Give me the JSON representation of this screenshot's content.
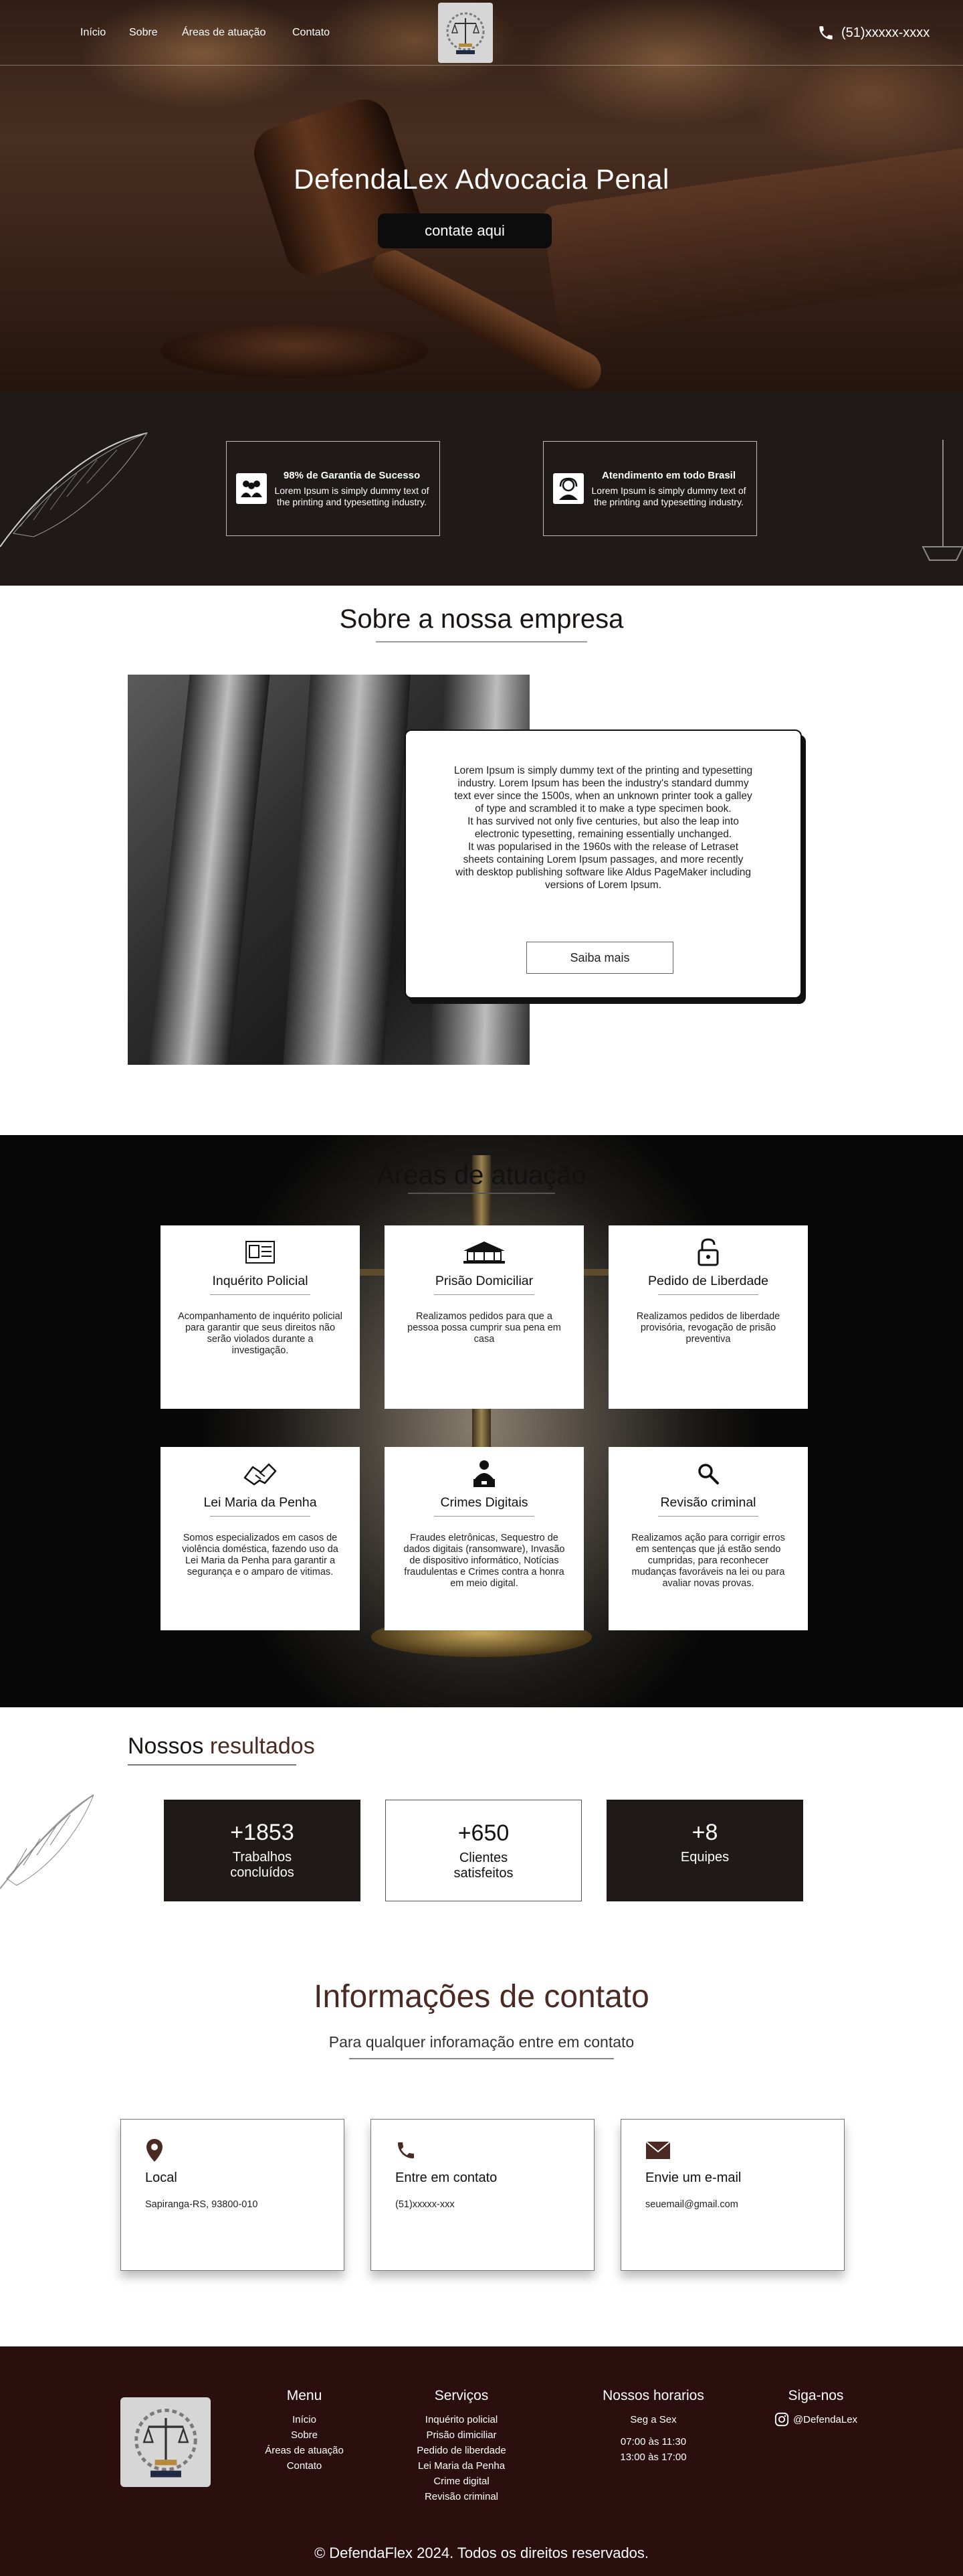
{
  "nav": {
    "links": [
      "Início",
      "Sobre",
      "Áreas de atuação",
      "Contato"
    ],
    "phone": "(51)xxxxx-xxxx"
  },
  "hero": {
    "title": "DefendaLex Advocacia Penal",
    "cta": "contate aqui"
  },
  "features": [
    {
      "title": "98% de Garantia de Sucesso",
      "text": "Lorem Ipsum is simply dummy text of the printing and typesetting industry.",
      "icon": "team-icon"
    },
    {
      "title": "Atendimento em todo Brasil",
      "text": "Lorem Ipsum is simply dummy text of the printing and typesetting industry.",
      "icon": "support-agent-icon"
    }
  ],
  "about": {
    "title": "Sobre a nossa empresa",
    "text": "Lorem Ipsum is simply dummy text of the printing and typesetting industry. Lorem Ipsum has been the industry's standard dummy text ever since the 1500s, when an unknown printer took a galley of type and scrambled it to make a type specimen book.\nIt has survived not only five centuries, but also the leap into electronic typesetting, remaining essentially unchanged.\nIt was popularised in the 1960s with the release of Letraset sheets containing Lorem Ipsum passages, and more recently with desktop publishing software like Aldus PageMaker including versions of Lorem Ipsum.",
    "button": "Saiba mais"
  },
  "areas": {
    "title": "Áreas de atuação",
    "items": [
      {
        "title": "Inquérito Policial",
        "text": "Acompanhamento de inquérito policial para garantir que seus direitos não serão violados durante a investigação.",
        "icon": "police-file-icon"
      },
      {
        "title": "Prisão Domiciliar",
        "text": "Realizamos pedidos para que a pessoa possa cumprir sua pena em casa",
        "icon": "house-icon"
      },
      {
        "title": "Pedido de Liberdade",
        "text": "Realizamos pedidos de liberdade provisória, revogação de prisão preventiva",
        "icon": "unlock-icon"
      },
      {
        "title": "Lei Maria da Penha",
        "text": "Somos especializados em casos de violência doméstica, fazendo uso da Lei Maria da Penha para garantir a segurança e o amparo de vitimas.",
        "icon": "handshake-icon"
      },
      {
        "title": "Crimes Digitais",
        "text": "Fraudes eletrônicas, Sequestro de dados digitais (ransomware), Invasão de dispositivo informático, Notícias fraudulentas e Crimes contra a honra em meio digital.",
        "icon": "computer-user-icon"
      },
      {
        "title": "Revisão criminal",
        "text": "Realizamos ação para corrigir erros em sentenças que já estão sendo cumpridas, para reconhecer mudanças favoráveis na lei ou para avaliar novas provas.",
        "icon": "search-icon"
      }
    ]
  },
  "results": {
    "title_a": "Nossos",
    "title_b": "resultados",
    "stats": [
      {
        "value": "+1853",
        "label_1": "Trabalhos",
        "label_2": "concluídos"
      },
      {
        "value": "+650",
        "label_1": "Clientes",
        "label_2": "satisfeitos"
      },
      {
        "value": "+8",
        "label_1": "Equipes",
        "label_2": ""
      }
    ]
  },
  "contact": {
    "title": "Informações de contato",
    "subtitle": "Para qualquer inforamação entre em contato",
    "cards": [
      {
        "title": "Local",
        "value": "Sapiranga-RS, 93800-010",
        "icon": "location-pin-icon"
      },
      {
        "title": "Entre em contato",
        "value": "(51)xxxxx-xxx",
        "icon": "phone-icon"
      },
      {
        "title": "Envie um e-mail",
        "value": "seuemail@gmail.com",
        "icon": "envelope-icon"
      }
    ]
  },
  "footer": {
    "menu_title": "Menu",
    "menu": [
      "Início",
      "Sobre",
      "Áreas de atuação",
      "Contato"
    ],
    "services_title": "Serviços",
    "services": [
      "Inquérito policial",
      "Prisão dimiciliar",
      "Pedido de liberdade",
      "Lei Maria da Penha",
      "Crime digital",
      "Revisão criminal"
    ],
    "hours_title": "Nossos horarios",
    "hours_days": "Seg a Sex",
    "hours": [
      "07:00 às 11:30",
      "13:00 às 17:00"
    ],
    "social_title": "Siga-nos",
    "social_handle": "@DefendaLex",
    "copyright": "© DefendaFlex 2024. Todos os direitos reservados."
  },
  "colors": {
    "dark_band": "#1f1a19",
    "footer": "#2b0f0f",
    "accent_brown": "#4a2a22"
  }
}
